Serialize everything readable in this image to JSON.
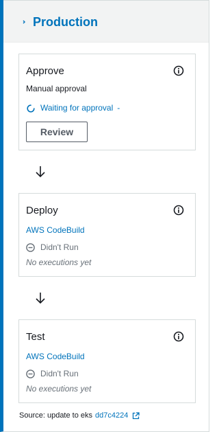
{
  "stage": {
    "name": "Production"
  },
  "actions": [
    {
      "title": "Approve",
      "subtitle": "Manual approval",
      "status": "Waiting for approval",
      "status_separator": "-",
      "button_label": "Review"
    },
    {
      "title": "Deploy",
      "provider": "AWS CodeBuild",
      "status": "Didn't Run",
      "executions": "No executions yet"
    },
    {
      "title": "Test",
      "provider": "AWS CodeBuild",
      "status": "Didn't Run",
      "executions": "No executions yet"
    }
  ],
  "source": {
    "label": "Source: update to eks",
    "commit": "dd7c4224"
  },
  "icons": {
    "collapse": "collapse-caret-icon",
    "info": "info-icon",
    "waiting": "spinner-icon",
    "not_run": "circle-minus-icon",
    "arrow": "arrow-down-icon",
    "external": "external-link-icon"
  },
  "colors": {
    "accent": "#0073bb",
    "muted": "#687078",
    "text": "#16191f",
    "border": "#d5dbdb",
    "header_bg": "#f2f3f3"
  }
}
